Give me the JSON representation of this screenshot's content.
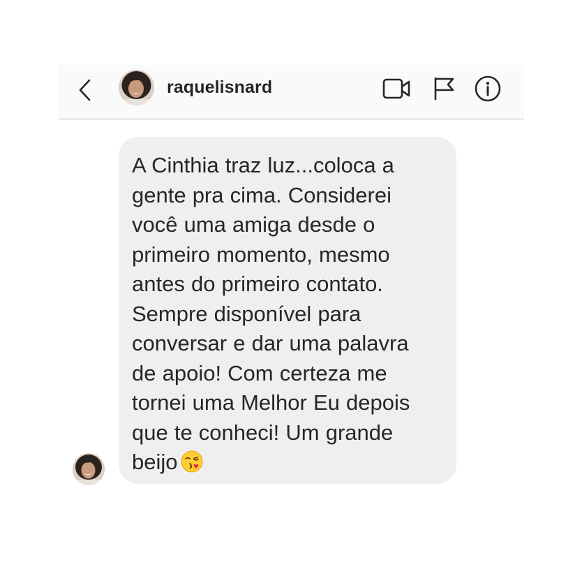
{
  "header": {
    "username": "raquelisnard",
    "icons": {
      "back": "chevron-left-icon",
      "video": "video-camera-icon",
      "flag": "flag-icon",
      "info": "info-icon"
    }
  },
  "message": {
    "text": "A Cinthia traz luz...coloca a\ngente pra cima. Considerei\nvocê uma amiga desde o\nprimeiro momento, mesmo\nantes do primeiro contato.\nSempre disponível para\nconversar e dar uma palavra\nde apoio! Com certeza me\ntornei uma Melhor Eu depois\nque te conheci! Um grande\nbeijo",
    "emoji": "kissing-face-with-heart-emoji"
  },
  "colors": {
    "header_bg": "#fafafa",
    "bubble_bg": "#efefef",
    "text": "#262626",
    "divider": "#bdbdbd"
  }
}
